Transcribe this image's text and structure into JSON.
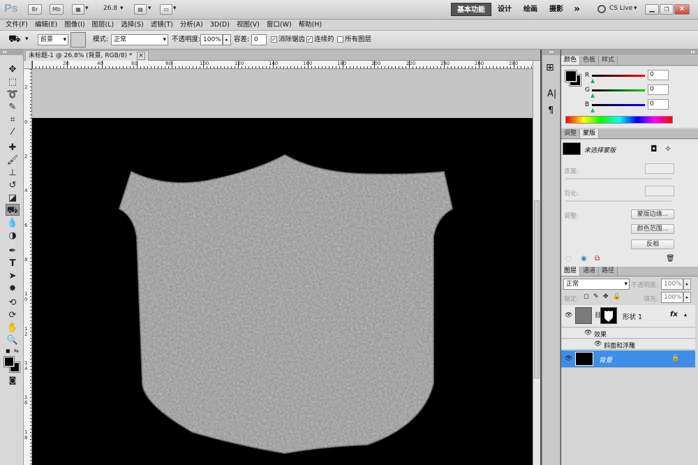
{
  "app": {
    "logo": "Ps",
    "bridge_label": "Br",
    "minibridge_label": "Mb",
    "zoom": "26.8",
    "workspaces": [
      "基本功能",
      "设计",
      "绘画",
      "摄影"
    ],
    "more": "»",
    "cslive": "CS Live"
  },
  "menu": [
    "文件(F)",
    "编辑(E)",
    "图像(I)",
    "图层(L)",
    "选择(S)",
    "滤镜(T)",
    "分析(A)",
    "3D(D)",
    "视图(V)",
    "窗口(W)",
    "帮助(H)"
  ],
  "options": {
    "fill_source": "前景",
    "mode_label": "模式:",
    "mode_value": "正常",
    "opacity_label": "不透明度:",
    "opacity_value": "100%",
    "tolerance_label": "容差:",
    "tolerance_value": "0",
    "antialias_label": "消除锯齿",
    "antialias_checked": "✓",
    "contiguous_label": "连续的",
    "contiguous_checked": "✓",
    "alllayers_label": "所有图层"
  },
  "document": {
    "tab_title": "未标题-1 @ 26.8% (背景, RGB/8) *",
    "close": "×",
    "h_ticks": [
      "20",
      "40",
      "60",
      "80",
      "100",
      "120",
      "140",
      "160",
      "180",
      "200",
      "220",
      "240",
      "260",
      "280"
    ],
    "v_ticks": [
      "2",
      "0",
      "2",
      "4",
      "6",
      "8",
      "1 0",
      "1 2",
      "1 4",
      "1 6",
      "1 8"
    ]
  },
  "color_panel": {
    "tabs": [
      "颜色",
      "色板",
      "样式"
    ],
    "r_label": "R",
    "g_label": "G",
    "b_label": "B",
    "r": "0",
    "g": "0",
    "b": "0",
    "foreground": "#000000"
  },
  "masks_panel": {
    "tabs": [
      "调整",
      "蒙版"
    ],
    "no_mask": "未选择蒙版",
    "density": "浓度:",
    "feather": "羽化:",
    "refine": "调整:",
    "edge_btn": "蒙版边缘...",
    "range_btn": "颜色范围...",
    "invert_btn": "反相"
  },
  "layers_panel": {
    "tabs": [
      "图层",
      "通道",
      "路径"
    ],
    "blend": "正常",
    "opacity_label": "不透明度:",
    "opacity": "100%",
    "lock_label": "锁定:",
    "fill_label": "填充:",
    "fill": "100%",
    "layers": [
      {
        "name": "形状 1",
        "fx": "fx"
      },
      {
        "name": "效果"
      },
      {
        "name": "斜面和浮雕"
      },
      {
        "name": "背景"
      }
    ]
  }
}
